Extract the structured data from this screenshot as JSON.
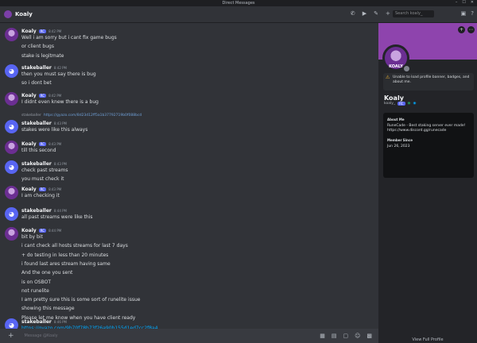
{
  "window": {
    "title": "Direct Messages"
  },
  "header": {
    "name": "Koaly",
    "search_placeholder": "Search koaly_"
  },
  "messages": [
    {
      "id": "m1",
      "author": "Koaly",
      "tag": "RC",
      "time": "8:42 PM",
      "avatar": "koaly",
      "lines": [
        "Well i am sorry but i cant fix game bugs",
        "or client bugs",
        "stake is legitmate"
      ]
    },
    {
      "id": "m2",
      "author": "stakeballer",
      "time": "8:42 PM",
      "avatar": "stake",
      "lines": [
        "then you must say there is bug",
        "so i dont bet"
      ]
    },
    {
      "id": "m3",
      "author": "Koaly",
      "tag": "RC",
      "time": "8:42 PM",
      "avatar": "koaly",
      "lines": [
        "I didnt even knew there is a bug"
      ]
    },
    {
      "id": "m4",
      "author": "stakeballer",
      "time": "8:43 PM",
      "avatar": "stake",
      "reply_author": "stakeballer",
      "reply_link": "https://gyazo.com/8d23d12ff5a1b37792719b0f088bcd",
      "lines": [
        "stakes were like this always"
      ]
    },
    {
      "id": "m5",
      "author": "Koaly",
      "tag": "RC",
      "time": "8:43 PM",
      "avatar": "koaly",
      "lines": [
        "till this second"
      ]
    },
    {
      "id": "m6",
      "author": "stakeballer",
      "time": "8:43 PM",
      "avatar": "stake",
      "lines": [
        "check past streams",
        "you must check it"
      ]
    },
    {
      "id": "m7",
      "author": "Koaly",
      "tag": "RC",
      "time": "8:43 PM",
      "avatar": "koaly",
      "lines": [
        "I am checking it"
      ]
    },
    {
      "id": "m8",
      "author": "stakeballer",
      "time": "8:44 PM",
      "avatar": "stake",
      "lines": [
        "all past streams were like this"
      ]
    },
    {
      "id": "m9",
      "author": "Koaly",
      "tag": "RC",
      "time": "8:44 PM",
      "avatar": "koaly",
      "lines": [
        "bit by bit",
        "i cant check all hosts streams for last 7 days",
        "+ do testing in less than 20 minutes",
        "i found last ares stream having same",
        "And the one you sent",
        "is on OSBOT",
        "not runelite",
        "I am pretty sure this is some sort of runelite issue",
        "showing this message",
        "Please let me know when you have client ready"
      ]
    },
    {
      "id": "m10",
      "author": "stakeballer",
      "time": "8:46 PM",
      "avatar": "stake",
      "lines": [
        "https://gyazo.com/9b70f78b73f26a90b155d1ed7cc2f8a4"
      ]
    }
  ],
  "composer": {
    "placeholder": "Message @Koaly"
  },
  "profile": {
    "avatar_text": "KOALY",
    "warning": "Unable to load profile banner, badges, and about me.",
    "name": "Koaly",
    "username": "koaly_",
    "tag": "RC",
    "about_label": "About Me",
    "about_text": "RuneCade - Best staking server ever made!",
    "about_link": "https://www.discord.gg/runecade",
    "member_label": "Member Since",
    "member_date": "Jun 26, 2023",
    "view_full": "View Full Profile"
  }
}
